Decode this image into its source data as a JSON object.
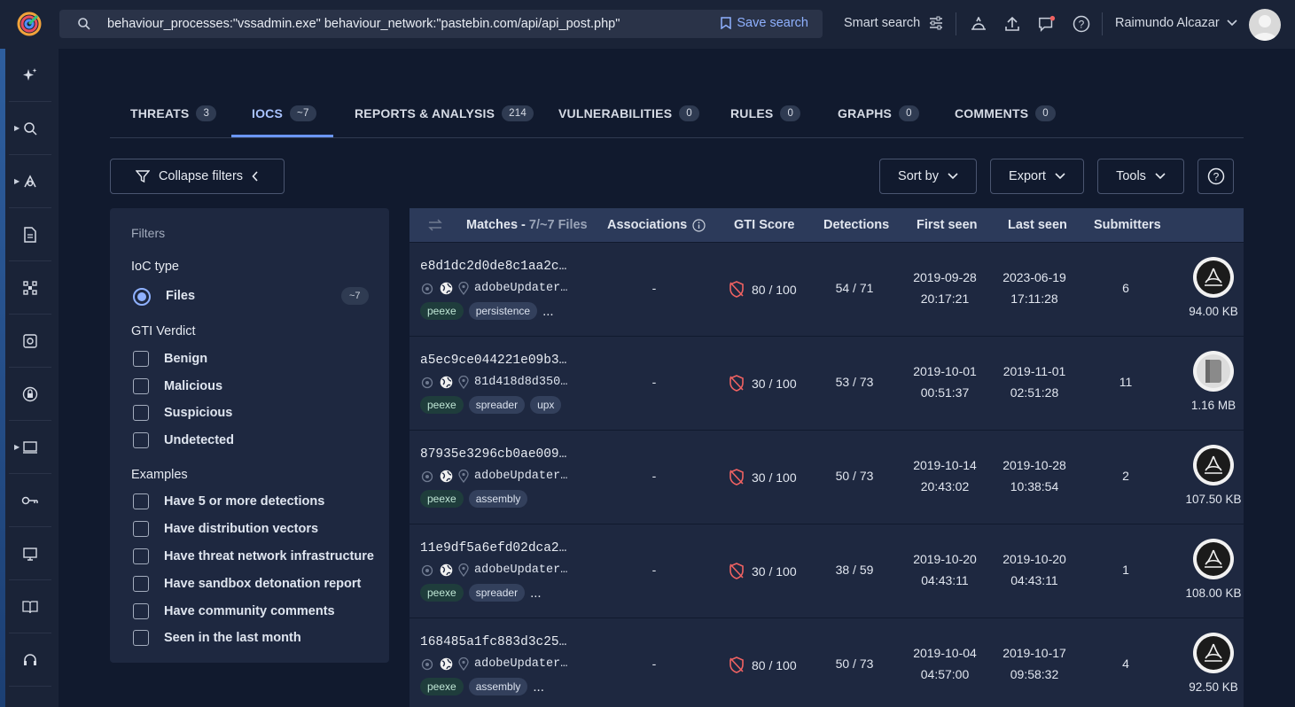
{
  "search": {
    "query": "behaviour_processes:\"vssadmin.exe\"  behaviour_network:\"pastebin.com/api/api_post.php\"",
    "save_label": "Save search"
  },
  "header": {
    "smart_search": "Smart search",
    "user_name": "Raimundo Alcazar"
  },
  "tabs": [
    {
      "label": "THREATS",
      "count": "3"
    },
    {
      "label": "IOCS",
      "count": "~7"
    },
    {
      "label": "REPORTS & ANALYSIS",
      "count": "214"
    },
    {
      "label": "VULNERABILITIES",
      "count": "0"
    },
    {
      "label": "RULES",
      "count": "0"
    },
    {
      "label": "GRAPHS",
      "count": "0"
    },
    {
      "label": "COMMENTS",
      "count": "0"
    }
  ],
  "toolbar": {
    "collapse_filters": "Collapse filters",
    "sort_by": "Sort by",
    "export": "Export",
    "tools": "Tools"
  },
  "filters": {
    "title": "Filters",
    "ioc_type": "IoC type",
    "files_label": "Files",
    "files_count": "~7",
    "gti_verdict": "GTI Verdict",
    "verdicts": [
      "Benign",
      "Malicious",
      "Suspicious",
      "Undetected"
    ],
    "examples_title": "Examples",
    "examples": [
      "Have 5 or more detections",
      "Have distribution vectors",
      "Have threat network infrastructure",
      "Have sandbox detonation report",
      "Have community comments",
      "Seen in the last month"
    ]
  },
  "table": {
    "headers": {
      "matches": "Matches -",
      "matches_count": "7/~7 Files",
      "associations": "Associations",
      "gti_score": "GTI Score",
      "detections": "Detections",
      "first_seen": "First seen",
      "last_seen": "Last seen",
      "submitters": "Submitters"
    },
    "rows": [
      {
        "hash": "e8d1dc2d0de8c1aa2c…",
        "name": "adobeUpdater…",
        "tags": [
          "peexe",
          "persistence"
        ],
        "more": "...",
        "assoc": "-",
        "gti": "80 / 100",
        "det": "54 / 71",
        "first_date": "2019-09-28",
        "first_time": "20:17:21",
        "last_date": "2023-06-19",
        "last_time": "17:11:28",
        "submitters": "6",
        "size": "94.00 KB",
        "icon": "pdf-icon"
      },
      {
        "hash": "a5ec9ce044221e09b3…",
        "name": "81d418d8d350…",
        "tags": [
          "peexe",
          "spreader",
          "upx"
        ],
        "more": "",
        "assoc": "-",
        "gti": "30 / 100",
        "det": "53 / 73",
        "first_date": "2019-10-01",
        "first_time": "00:51:37",
        "last_date": "2019-11-01",
        "last_time": "02:51:28",
        "submitters": "11",
        "size": "1.16 MB",
        "icon": "file-icon"
      },
      {
        "hash": "87935e3296cb0ae009…",
        "name": "adobeUpdater…",
        "tags": [
          "peexe",
          "assembly"
        ],
        "more": "",
        "assoc": "-",
        "gti": "30 / 100",
        "det": "50 / 73",
        "first_date": "2019-10-14",
        "first_time": "20:43:02",
        "last_date": "2019-10-28",
        "last_time": "10:38:54",
        "submitters": "2",
        "size": "107.50 KB",
        "icon": "pdf-icon"
      },
      {
        "hash": "11e9df5a6efd02dca2…",
        "name": "adobeUpdater…",
        "tags": [
          "peexe",
          "spreader"
        ],
        "more": "...",
        "assoc": "-",
        "gti": "30 / 100",
        "det": "38 / 59",
        "first_date": "2019-10-20",
        "first_time": "04:43:11",
        "last_date": "2019-10-20",
        "last_time": "04:43:11",
        "submitters": "1",
        "size": "108.00 KB",
        "icon": "pdf-icon"
      },
      {
        "hash": "168485a1fc883d3c25…",
        "name": "adobeUpdater…",
        "tags": [
          "peexe",
          "assembly"
        ],
        "more": "...",
        "assoc": "-",
        "gti": "80 / 100",
        "det": "50 / 73",
        "first_date": "2019-10-04",
        "first_time": "04:57:00",
        "last_date": "2019-10-17",
        "last_time": "09:58:32",
        "submitters": "4",
        "size": "92.50 KB",
        "icon": "pdf-icon"
      }
    ]
  },
  "colors": {
    "accent": "#8fb1ff",
    "tab_active": "#6b96f5",
    "danger": "#f06262"
  }
}
